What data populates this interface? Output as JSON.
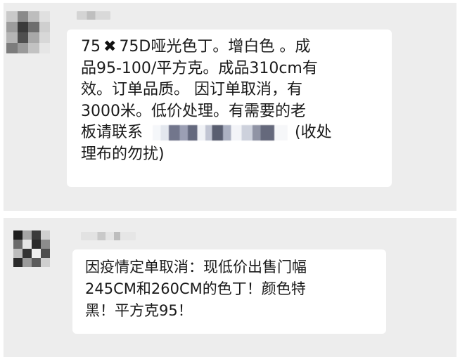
{
  "messages": [
    {
      "lines": [
        {
          "pre": "75",
          "mark": "✖",
          "post": "75D哑光色丁。增白色 。成"
        },
        "品95-100/平方克。成品310cm有",
        "效。订单品质。 因订单取消，有",
        "3000米。低价处理。有需要的老",
        {
          "pre": "板请联系",
          "post": "(收处"
        },
        "理布的勿扰)"
      ]
    },
    {
      "lines": [
        "因疫情定单取消：现低价出售门幅",
        "245CM和260CM的色丁！颜色特",
        "黑！平方克95！"
      ]
    }
  ],
  "colors": {
    "panel_background": "#ededed",
    "bubble_background": "#ffffff",
    "text": "#1a1a1a"
  },
  "icons": {
    "multiply_mark": "heavy-multiplication-x-icon"
  }
}
